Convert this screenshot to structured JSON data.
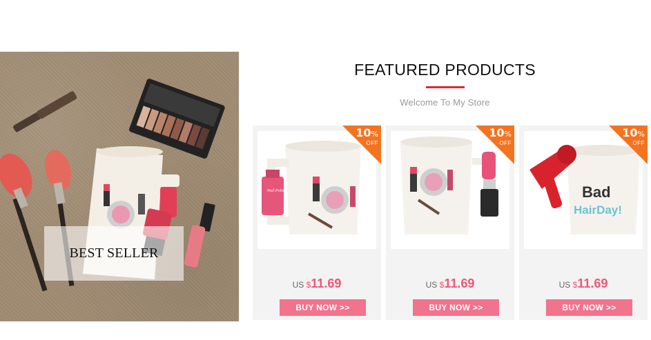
{
  "hero": {
    "label": "BEST SELLER"
  },
  "section": {
    "title": "FEATURED PRODUCTS",
    "subtitle": "Welcome To My Store",
    "accent_color": "#d72b33"
  },
  "products": [
    {
      "discount": "10",
      "discount_unit": "%",
      "discount_off": "OFF",
      "currency_prefix": "US",
      "currency_symbol": "$",
      "price": "11.69",
      "buy_label": "BUY NOW >>",
      "mug_text": "Nail Polish"
    },
    {
      "discount": "10",
      "discount_unit": "%",
      "discount_off": "OFF",
      "currency_prefix": "US",
      "currency_symbol": "$",
      "price": "11.69",
      "buy_label": "BUY NOW >>",
      "mug_text": ""
    },
    {
      "discount": "10",
      "discount_unit": "%",
      "discount_off": "OFF",
      "currency_prefix": "US",
      "currency_symbol": "$",
      "price": "11.69",
      "buy_label": "BUY NOW >>",
      "mug_text_line1": "Bad",
      "mug_text_line2": "HairDay!"
    }
  ],
  "colors": {
    "ribbon": "#f37321",
    "price": "#f0547a",
    "button": "#f2738c"
  }
}
